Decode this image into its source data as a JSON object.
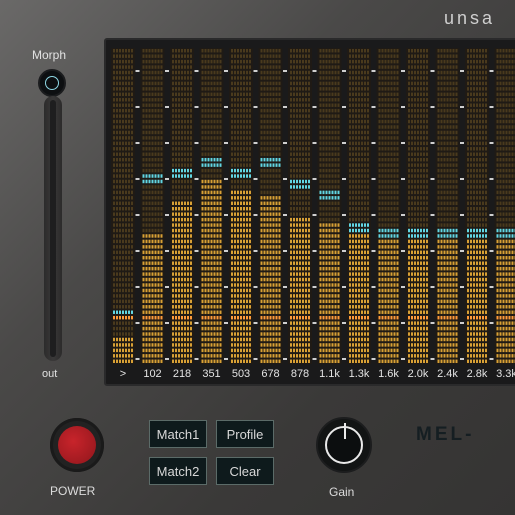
{
  "brand": "unsa",
  "model": "MEL-",
  "morph": {
    "label": "Morph",
    "out_label": "out"
  },
  "eq": {
    "bands": [
      {
        "label": ">",
        "level": 0.08,
        "peak": 0.16
      },
      {
        "label": "102",
        "level": 0.42,
        "peak": 0.58
      },
      {
        "label": "218",
        "level": 0.52,
        "peak": 0.61
      },
      {
        "label": "351",
        "level": 0.58,
        "peak": 0.63
      },
      {
        "label": "503",
        "level": 0.56,
        "peak": 0.61
      },
      {
        "label": "678",
        "level": 0.53,
        "peak": 0.63
      },
      {
        "label": "878",
        "level": 0.47,
        "peak": 0.57
      },
      {
        "label": "1.1k",
        "level": 0.44,
        "peak": 0.53
      },
      {
        "label": "1.3k",
        "level": 0.43,
        "peak": 0.43
      },
      {
        "label": "1.6k",
        "level": 0.41,
        "peak": 0.41
      },
      {
        "label": "2.0k",
        "level": 0.41,
        "peak": 0.41
      },
      {
        "label": "2.4k",
        "level": 0.42,
        "peak": 0.42
      },
      {
        "label": "2.8k",
        "level": 0.42,
        "peak": 0.42
      },
      {
        "label": "3.3k",
        "level": 0.41,
        "peak": 0.41
      }
    ]
  },
  "controls": {
    "power_label": "POWER",
    "match1": "Match1",
    "match2": "Match2",
    "profile": "Profile",
    "clear": "Clear",
    "gain_label": "Gain"
  },
  "colors": {
    "bar": "#d9a135",
    "peak": "#62d7e4",
    "marker": "#ff9b3a"
  }
}
